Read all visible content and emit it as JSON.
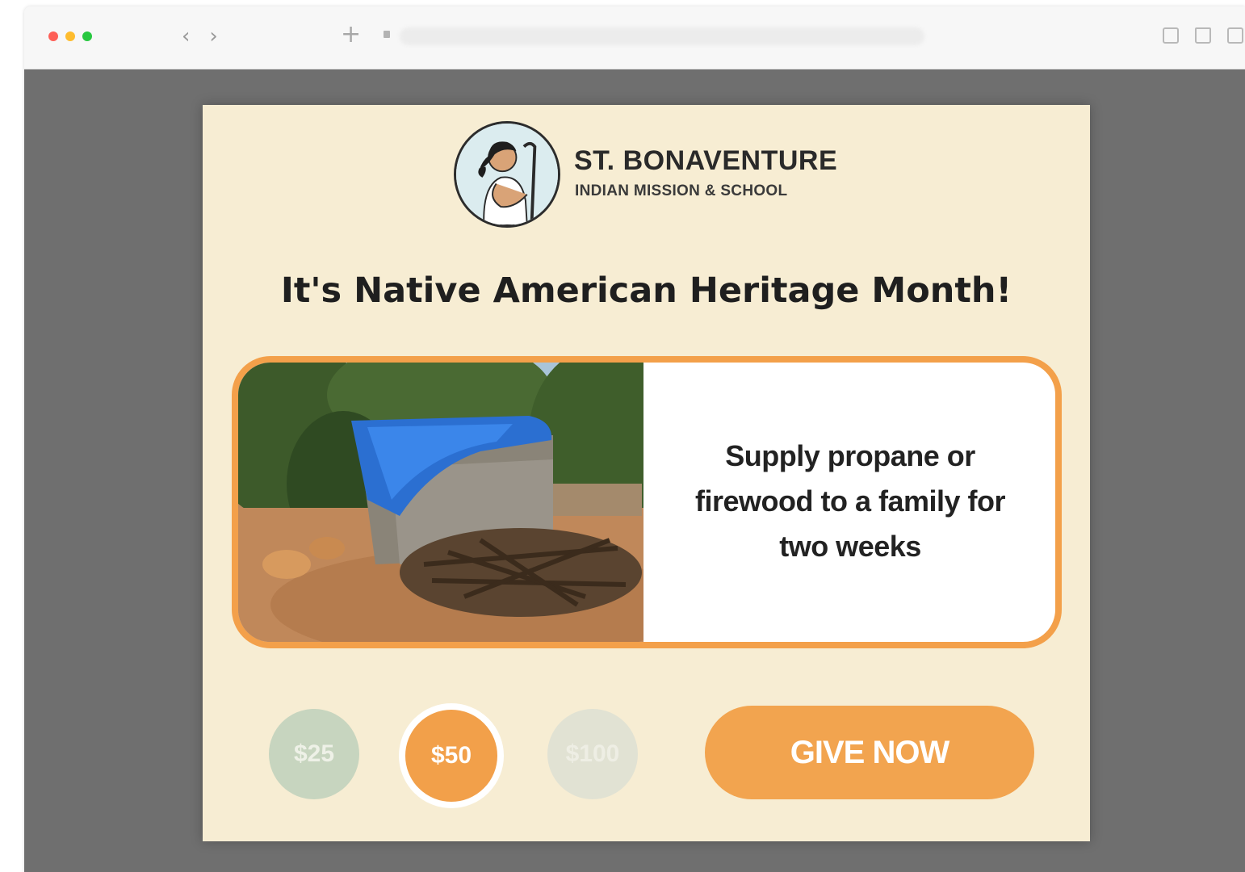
{
  "browser": {
    "back_label": "‹",
    "forward_label": "›",
    "new_tab_label": "+"
  },
  "popup": {
    "org_name": "ST. BONAVENTURE",
    "org_subtitle": "INDIAN MISSION & SCHOOL",
    "headline": "It's Native American Heritage Month!",
    "appeal_text": "Supply propane or firewood to a family for two weeks",
    "amounts": [
      "$25",
      "$50",
      "$100"
    ],
    "selected_amount": "$50",
    "give_button": "GIVE NOW"
  },
  "colors": {
    "card_bg": "#f7edd3",
    "accent_orange": "#f3a04a",
    "overlay_gray": "#6f6f6f",
    "amount_green": "#c7d5bf"
  },
  "icons": [
    "back-chevron-icon",
    "forward-chevron-icon",
    "plus-icon",
    "lock-icon",
    "reader-icon",
    "share-icon",
    "tabs-icon"
  ]
}
